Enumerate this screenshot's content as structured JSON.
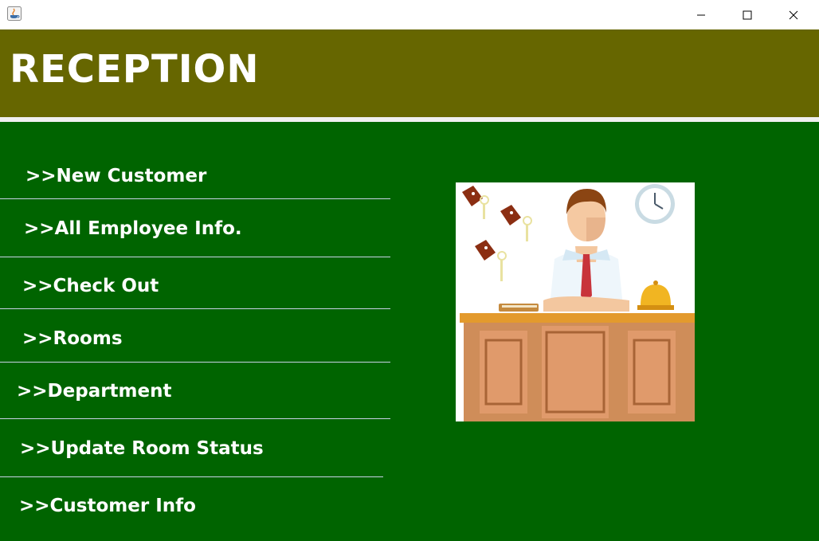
{
  "window": {
    "icon": "java-cup-icon",
    "controls": [
      "minimize-icon",
      "maximize-icon",
      "close-icon"
    ]
  },
  "header": {
    "title": "RECEPTION",
    "color": "#666600"
  },
  "colors": {
    "main_bg": "#006400",
    "text": "#ffffff"
  },
  "menu": {
    "items": [
      {
        "label": ">>New Customer"
      },
      {
        "label": ">>All Employee Info."
      },
      {
        "label": ">>Check Out"
      },
      {
        "label": ">>Rooms"
      },
      {
        "label": ">>Department"
      },
      {
        "label": ">>Update Room Status"
      },
      {
        "label": ">>Customer Info"
      }
    ]
  },
  "illustration": {
    "icon": "receptionist-desk-illustration"
  }
}
